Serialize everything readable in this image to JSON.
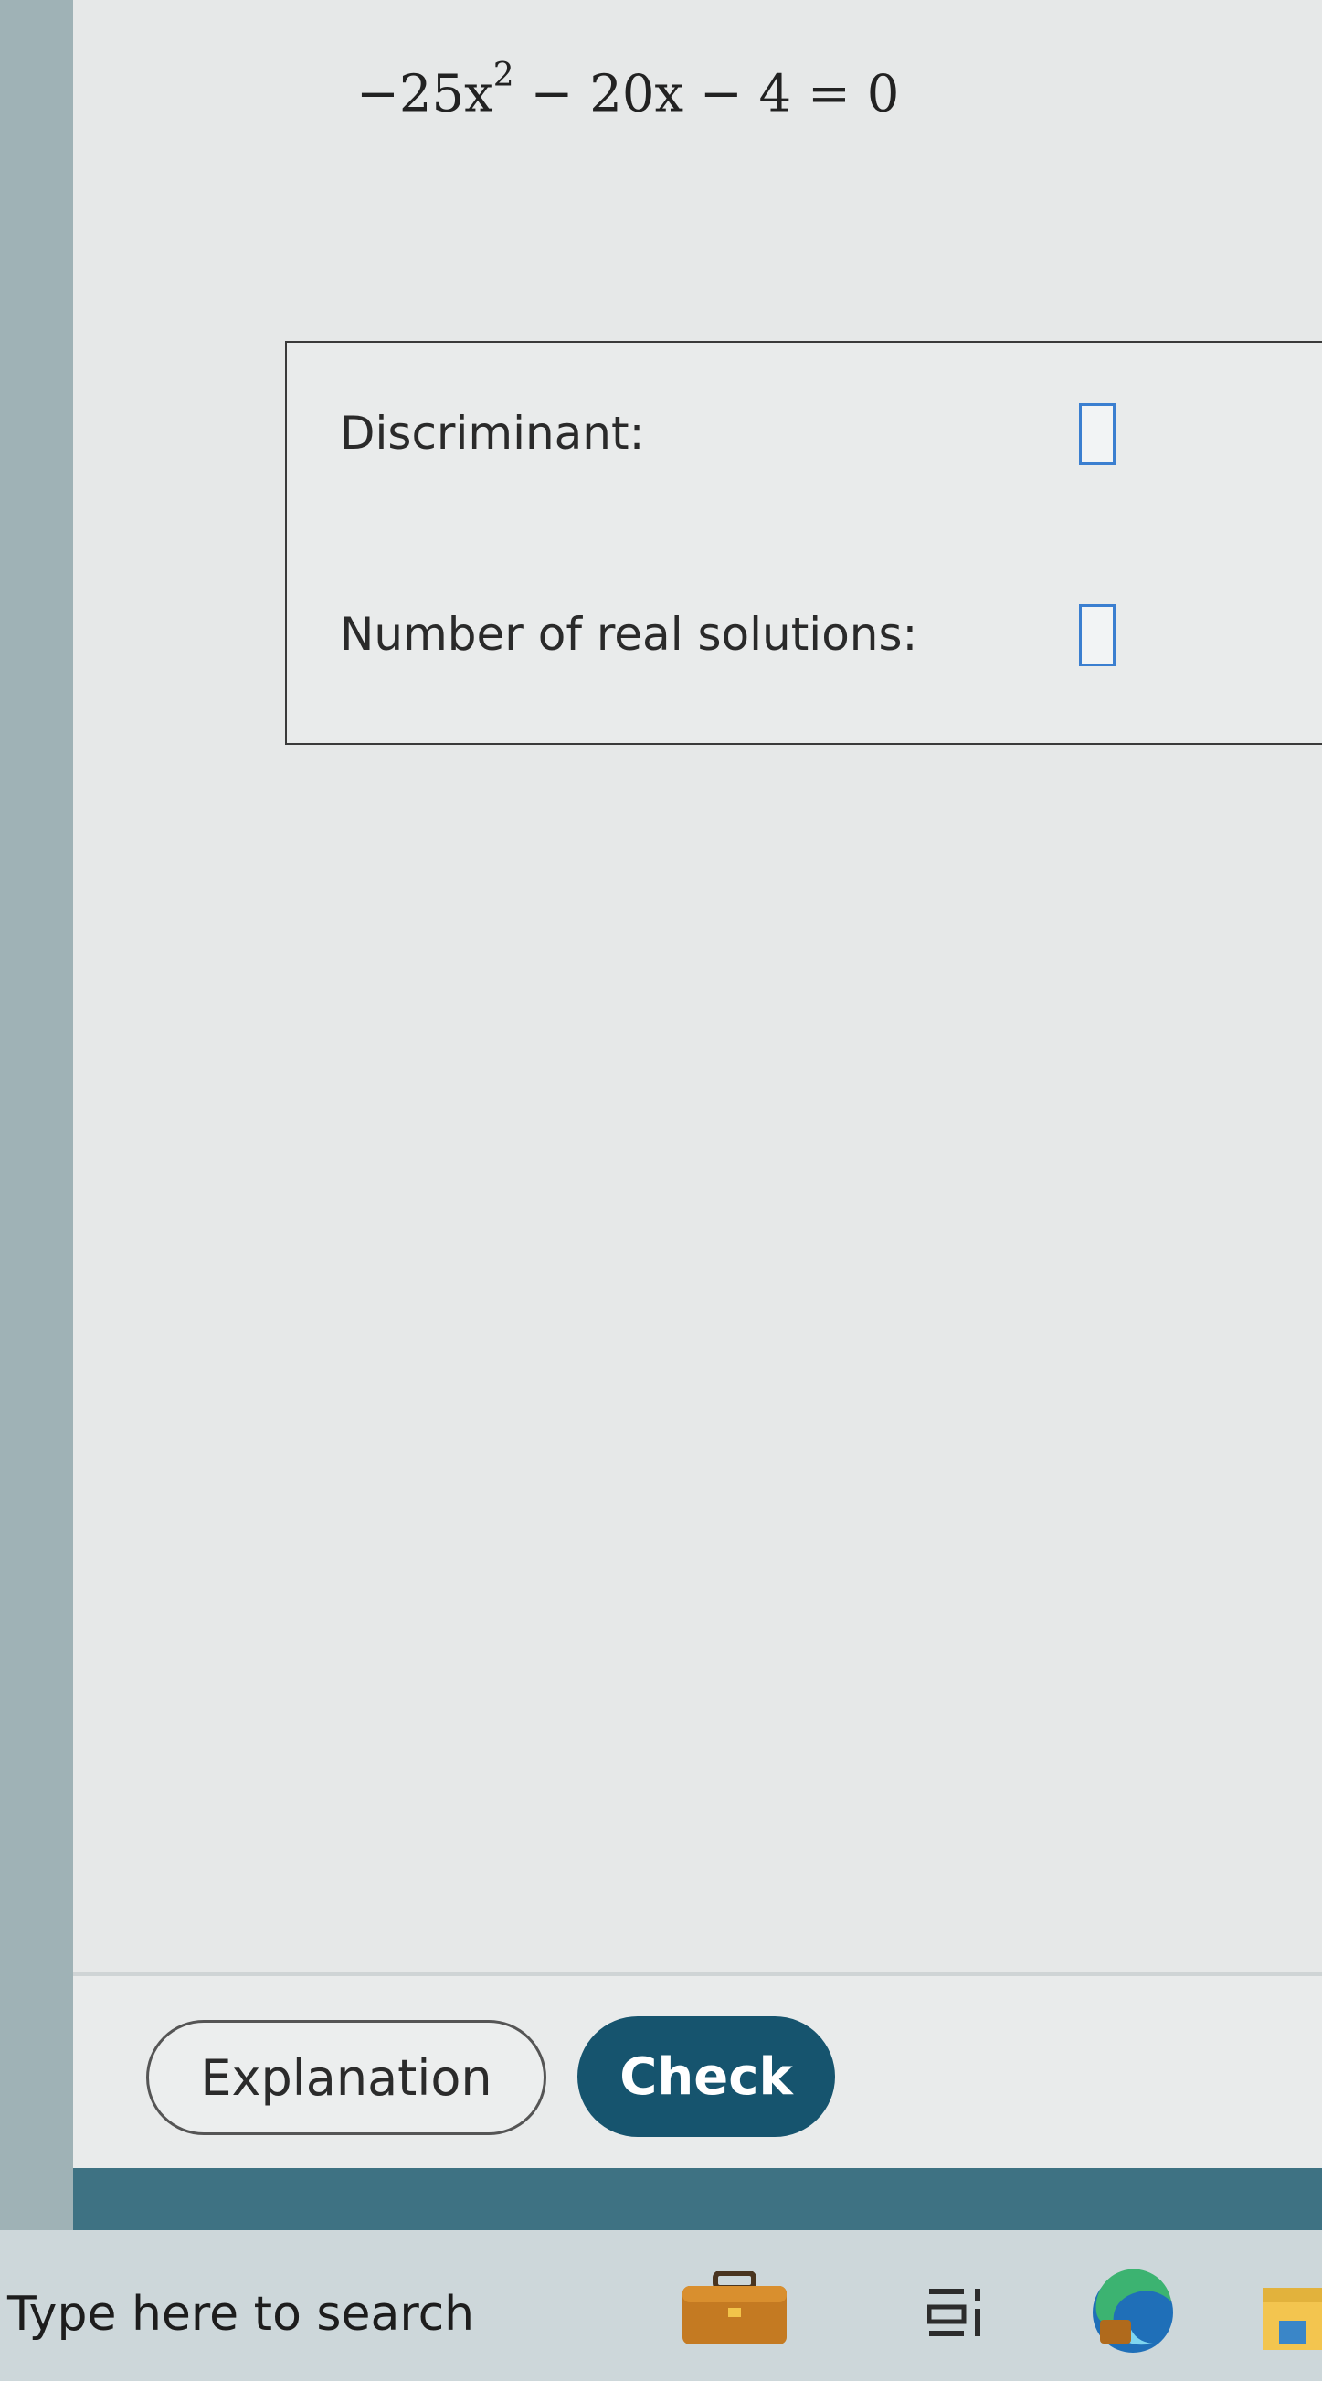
{
  "problem": {
    "equation_parts": {
      "lead": "−25x",
      "exponent": "2",
      "rest": " − 20x − 4 = 0"
    }
  },
  "answers": {
    "discriminant_label": "Discriminant:",
    "solutions_label": "Number of real solutions:",
    "discriminant_value": "",
    "solutions_value": ""
  },
  "footer": {
    "explanation_label": "Explanation",
    "check_label": "Check"
  },
  "taskbar": {
    "search_placeholder": "Type here to search"
  },
  "colors": {
    "check_button": "#16546e",
    "input_border": "#3b7fd0",
    "bottom_band": "#3e7283"
  }
}
